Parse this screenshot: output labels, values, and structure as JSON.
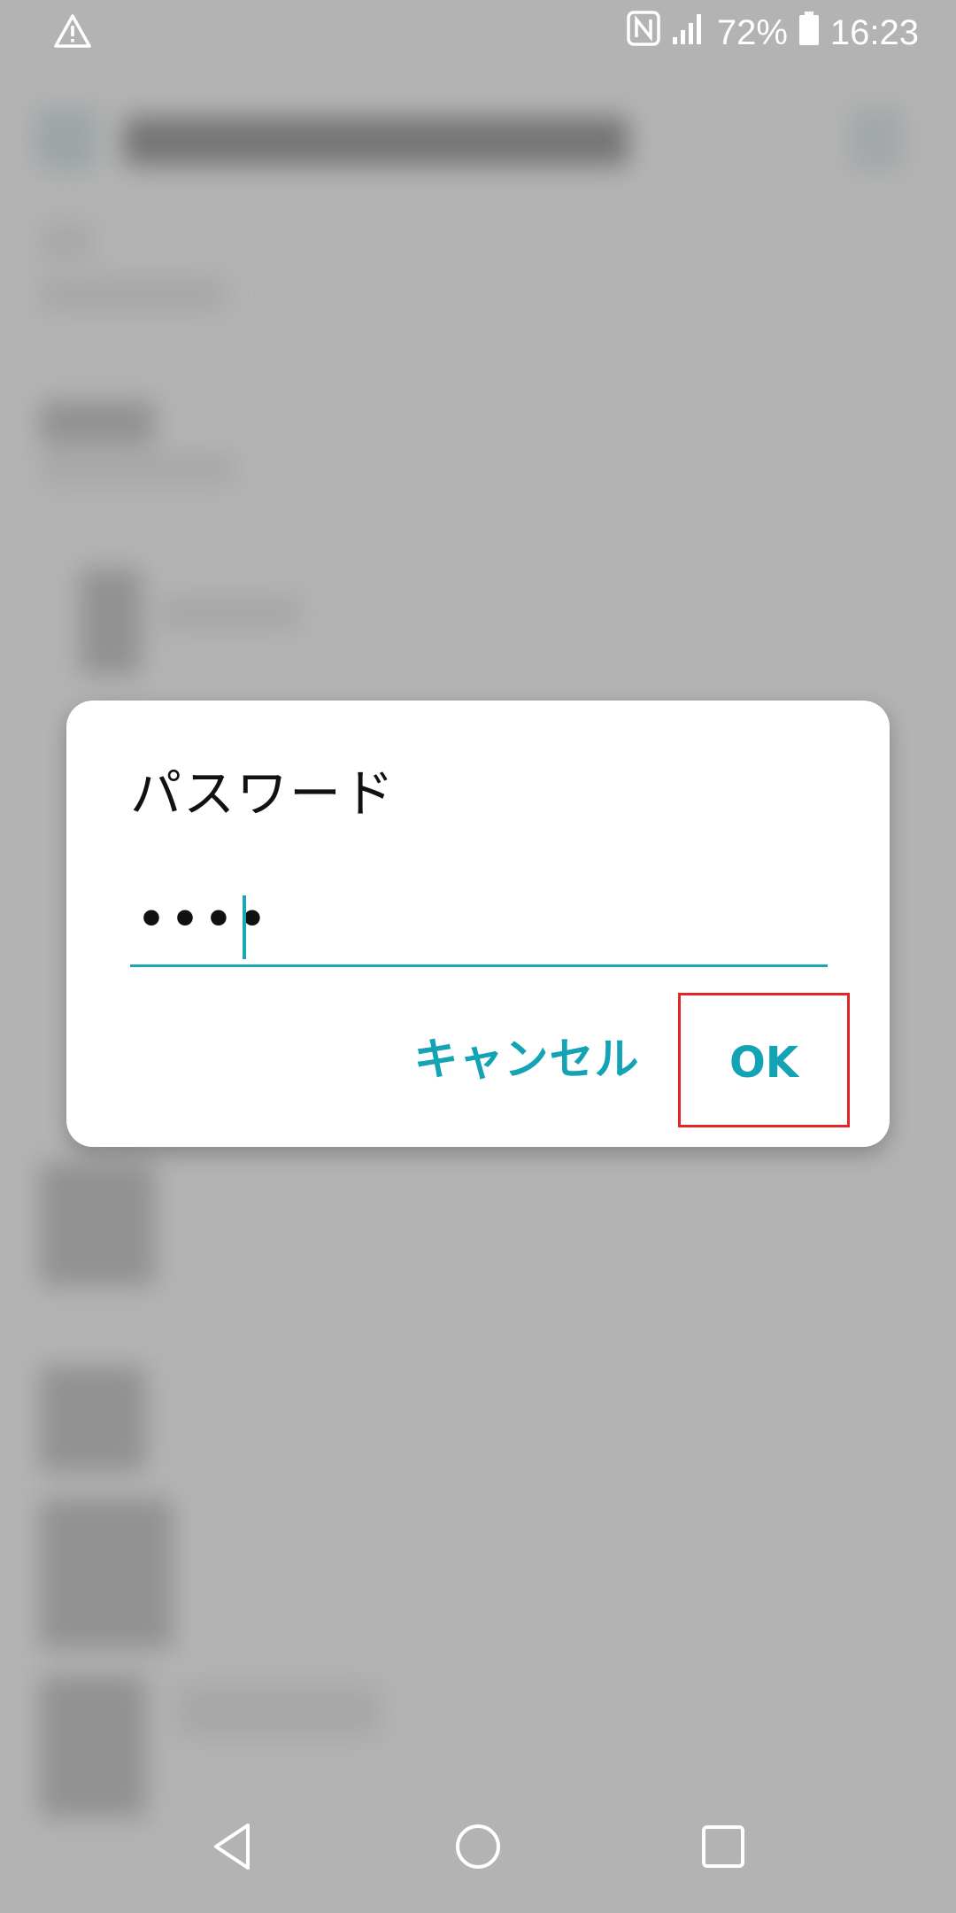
{
  "status_bar": {
    "battery_percent": "72%",
    "time": "16:23",
    "icons": [
      "warning-icon",
      "nfc-icon",
      "signal-icon",
      "battery-icon"
    ]
  },
  "dialog": {
    "title": "パスワード",
    "password_masked": "••••",
    "cancel_label": "キャンセル",
    "ok_label": "OK"
  },
  "nav_bar": {
    "icons": [
      "back-icon",
      "home-icon",
      "recents-icon"
    ]
  },
  "colors": {
    "accent": "#19a7b6",
    "highlight_box": "#e3262a",
    "scrim": "#b3b3b3"
  }
}
